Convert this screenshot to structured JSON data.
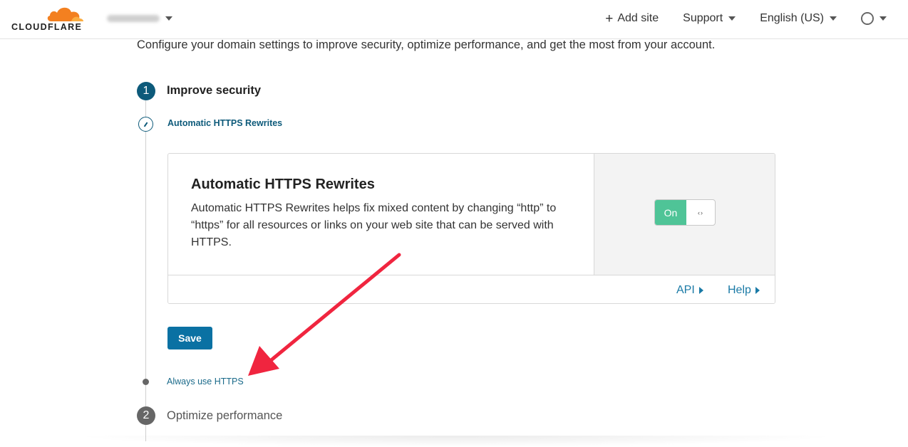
{
  "header": {
    "logo_text": "CLOUDFLARE",
    "add_site_label": "Add site",
    "support_label": "Support",
    "language_label": "English (US)"
  },
  "intro": "Configure your domain settings to improve security, optimize performance, and get the most from your account.",
  "steps": [
    {
      "number": "1",
      "title": "Improve security",
      "substeps": [
        "Automatic HTTPS Rewrites",
        "Always use HTTPS"
      ]
    },
    {
      "number": "2",
      "title": "Optimize performance"
    }
  ],
  "card": {
    "title": "Automatic HTTPS Rewrites",
    "description": "Automatic HTTPS Rewrites helps fix mixed content by changing “http” to “https” for all resources or links on your web site that can be served with HTTPS.",
    "toggle_label": "On",
    "toggle_state": true,
    "api_link": "API",
    "help_link": "Help"
  },
  "save_label": "Save",
  "colors": {
    "brand_orange": "#f38020",
    "step_active": "#0d5a7a",
    "toggle_on": "#4fc497",
    "button_blue": "#0a71a3",
    "link_blue": "#1a7aa6",
    "annotation_arrow": "#f0253f"
  },
  "icons": {
    "logo": "cloud-icon",
    "plus": "plus-icon",
    "avatar": "user-avatar-icon",
    "edit": "pencil-icon",
    "toggle_handle": "drag-handle-icon"
  }
}
